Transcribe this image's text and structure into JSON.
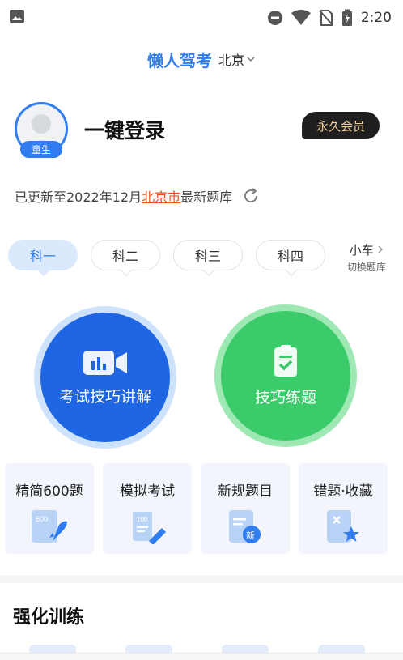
{
  "status_bar": {
    "time": "2:20"
  },
  "header": {
    "app_title": "懒人驾考",
    "city": "北京"
  },
  "profile": {
    "avatar_badge": "童生",
    "login_label": "一键登录",
    "vip_label": "永久会员"
  },
  "update": {
    "prefix": "已更新至2022年12月",
    "city": "北京市",
    "suffix": "最新题库"
  },
  "tabs": [
    {
      "label": "科一",
      "active": true
    },
    {
      "label": "科二",
      "active": false
    },
    {
      "label": "科三",
      "active": false
    },
    {
      "label": "科四",
      "active": false
    }
  ],
  "car_switch": {
    "label": "小车",
    "sub": "切换题库"
  },
  "main_actions": {
    "exam_tips": "考试技巧讲解",
    "practice": "技巧练题"
  },
  "cards": [
    {
      "title": "精简600题",
      "icon": "rocket-600-icon"
    },
    {
      "title": "模拟考试",
      "icon": "exam-paper-pencil-icon"
    },
    {
      "title": "新规题目",
      "icon": "new-rules-doc-icon"
    },
    {
      "title": "错题·收藏",
      "icon": "wrong-star-doc-icon"
    }
  ],
  "section": {
    "title": "强化训练"
  },
  "colors": {
    "brand_blue": "#2f7df0",
    "deep_blue": "#1f66e5",
    "green": "#3ccb6a",
    "accent_orange": "#e8531f",
    "vip_gold": "#f3d39a"
  }
}
